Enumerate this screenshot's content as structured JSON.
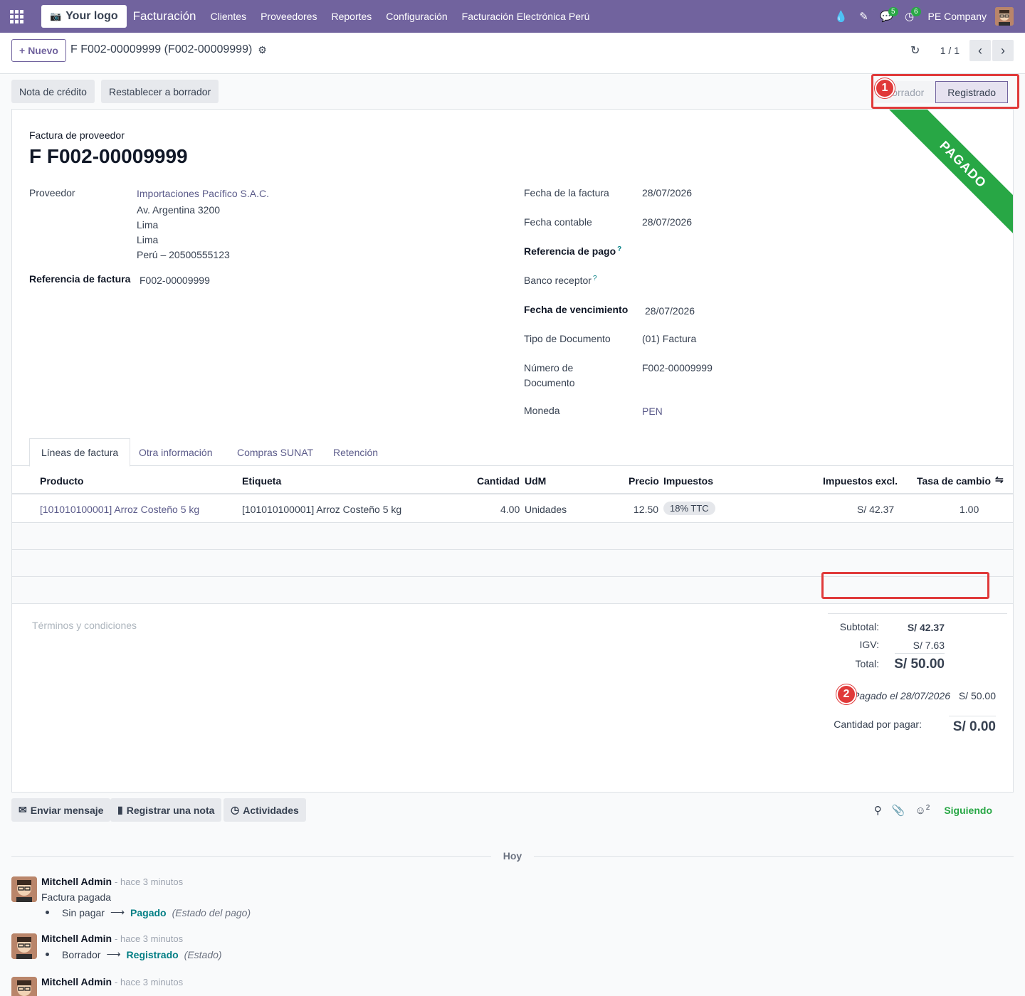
{
  "navbar": {
    "logo": "Your logo",
    "app_name": "Facturación",
    "menu": [
      "Clientes",
      "Proveedores",
      "Reportes",
      "Configuración",
      "Facturación Electrónica Perú"
    ],
    "messages_badge": "5",
    "activities_badge": "6",
    "company": "PE Company"
  },
  "control": {
    "new_button": "Nuevo",
    "breadcrumb": "F F002-00009999 (F002-00009999)",
    "pager": "1 / 1"
  },
  "actions": {
    "credit_note": "Nota de crédito",
    "reset_draft": "Restablecer a borrador"
  },
  "status": {
    "stages": [
      "Borrador",
      "Registrado"
    ],
    "active": "Registrado",
    "ribbon": "PAGADO"
  },
  "markers": {
    "m1": "1",
    "m2": "2"
  },
  "form": {
    "doc_kind": "Factura de proveedor",
    "title": "F F002-00009999",
    "vendor_label": "Proveedor",
    "vendor_name": "Importaciones Pacífico S.A.C.",
    "vendor_address": [
      "Av. Argentina 3200",
      "Lima",
      "Lima",
      "Perú – 20500555123"
    ],
    "ref_label": "Referencia de factura",
    "ref_value": "F002-00009999",
    "invoice_date_label": "Fecha de la factura",
    "invoice_date": "28/07/2026",
    "accounting_date_label": "Fecha contable",
    "accounting_date": "28/07/2026",
    "payment_ref_label": "Referencia de pago",
    "bank_label": "Banco receptor",
    "due_date_label": "Fecha de vencimiento",
    "due_date": "28/07/2026",
    "doc_type_label": "Tipo de Documento",
    "doc_type": "(01) Factura",
    "doc_number_label_1": "Número de",
    "doc_number_label_2": "Documento",
    "doc_number": "F002-00009999",
    "currency_label": "Moneda",
    "currency": "PEN"
  },
  "tabs": [
    "Líneas de factura",
    "Otra información",
    "Compras SUNAT",
    "Retención"
  ],
  "table": {
    "headers": [
      "Producto",
      "Etiqueta",
      "Cantidad",
      "UdM",
      "Precio",
      "Impuestos",
      "Impuestos excl.",
      "Tasa de cambio"
    ],
    "rows": [
      {
        "product": "[101010100001] Arroz Costeño 5 kg",
        "label": "[101010100001] Arroz Costeño 5 kg",
        "qty": "4.00",
        "uom": "Unidades",
        "price": "12.50",
        "tax": "18% TTC",
        "subtotal": "S/ 42.37",
        "rate": "1.00"
      }
    ]
  },
  "terms_placeholder": "Términos y condiciones",
  "totals": {
    "subtotal_label": "Subtotal:",
    "subtotal": "S/ 42.37",
    "igv_label": "IGV:",
    "igv": "S/ 7.63",
    "total_label": "Total:",
    "total": "S/ 50.00",
    "paid_label": "Pagado el 28/07/2026",
    "paid_amount": "S/ 50.00",
    "due_label": "Cantidad por pagar:",
    "due": "S/ 0.00"
  },
  "chatter": {
    "send_message": "Enviar mensaje",
    "log_note": "Registrar una nota",
    "activities": "Actividades",
    "followers_count": "2",
    "following": "Siguiendo",
    "date_separator": "Hoy",
    "messages": [
      {
        "author": "Mitchell Admin",
        "when": "- hace 3 minutos",
        "body": "Factura pagada",
        "old": "Sin pagar",
        "new": "Pagado",
        "field": "(Estado del pago)"
      },
      {
        "author": "Mitchell Admin",
        "when": "- hace 3 minutos",
        "old": "Borrador",
        "new": "Registrado",
        "field": "(Estado)"
      },
      {
        "author": "Mitchell Admin",
        "when": "- hace 3 minutos"
      }
    ]
  }
}
